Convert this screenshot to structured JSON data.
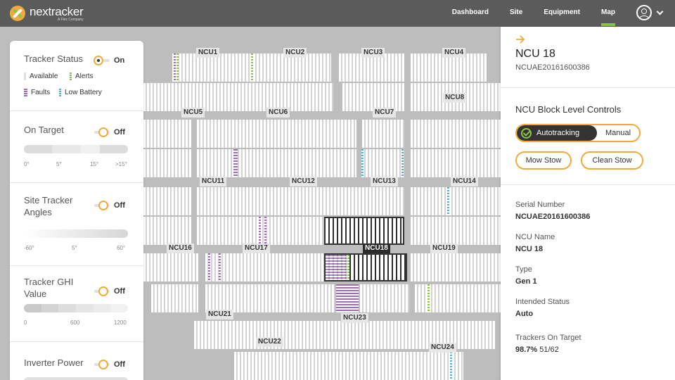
{
  "header": {
    "logo_name": "nextracker",
    "logo_sub": "A Flex Company",
    "nav": [
      {
        "label": "Dashboard"
      },
      {
        "label": "Site"
      },
      {
        "label": "Equipment"
      },
      {
        "label": "Map"
      }
    ],
    "active_nav": "Map"
  },
  "map": {
    "ncus": [
      "NCU1",
      "NCU2",
      "NCU3",
      "NCU4",
      "NCU5",
      "NCU6",
      "NCU7",
      "NCU8",
      "NCU11",
      "NCU12",
      "NCU13",
      "NCU14",
      "NCU16",
      "NCU17",
      "NCU18",
      "NCU19",
      "NCU21",
      "NCU22",
      "NCU23",
      "NCU24"
    ],
    "selected": "NCU18"
  },
  "left_panel": {
    "tracker_status": {
      "title": "Tracker Status",
      "toggle": "On",
      "legend": {
        "available": "Available",
        "alerts": "Alerts",
        "faults": "Faults",
        "low_battery": "Low Battery"
      }
    },
    "on_target": {
      "title": "On Target",
      "toggle": "Off",
      "ticks": [
        "0°",
        "5°",
        "15°",
        ">15°"
      ]
    },
    "site_angles": {
      "title": "Site Tracker Angles",
      "toggle": "Off",
      "ticks": [
        "-60°",
        "5°",
        "60°"
      ]
    },
    "ghi": {
      "title": "Tracker GHI Value",
      "toggle": "Off",
      "ticks": [
        "0",
        "600",
        "1200"
      ]
    },
    "inverter": {
      "title": "Inverter Power",
      "toggle": "Off"
    }
  },
  "right_panel": {
    "title": "NCU 18",
    "subtitle": "NCUAE20161600386",
    "controls_title": "NCU Block Level Controls",
    "autotracking": "Autotracking",
    "manual": "Manual",
    "mow_stow": "Mow Stow",
    "clean_stow": "Clean Stow",
    "serial_label": "Serial Number",
    "serial_value": "NCUAE20161600386",
    "name_label": "NCU Name",
    "name_value": "NCU 18",
    "type_label": "Type",
    "type_value": "Gen 1",
    "intended_label": "Intended Status",
    "intended_value": "Auto",
    "on_target_label": "Trackers On Target",
    "on_target_pct": "98.7%",
    "on_target_count": "51/62"
  },
  "colors": {
    "accent": "#f0ab3c",
    "green": "#8bc34a",
    "header": "#5b5b5b"
  }
}
